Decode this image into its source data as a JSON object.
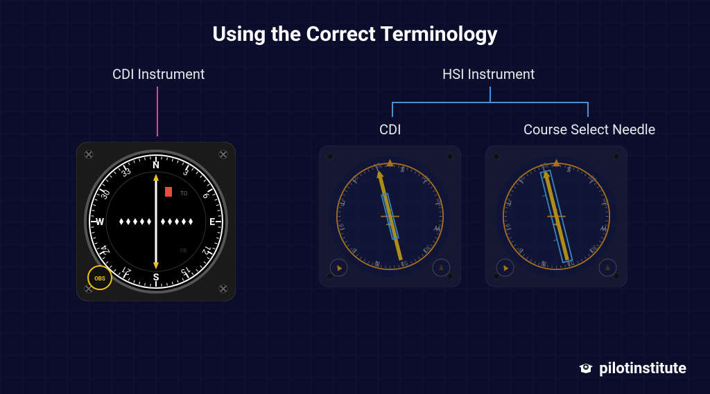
{
  "title": "Using the Correct Terminology",
  "labels": {
    "cdi_instrument": "CDI Instrument",
    "hsi_instrument": "HSI Instrument",
    "cdi": "CDI",
    "course_select": "Course Select Needle"
  },
  "cdi_gauge": {
    "obs": "OBS",
    "to": "TO",
    "fr": "FR",
    "cardinals": [
      "N",
      "E",
      "S",
      "W"
    ],
    "numbers": [
      "3",
      "6",
      "12",
      "15",
      "21",
      "24",
      "30",
      "33"
    ]
  },
  "hsi_gauge": {
    "cardinals": [
      "N",
      "E",
      "S",
      "W"
    ],
    "numbers": [
      "3",
      "6",
      "12",
      "15",
      "21",
      "24",
      "30",
      "33"
    ]
  },
  "brand": "pilotinstitute"
}
